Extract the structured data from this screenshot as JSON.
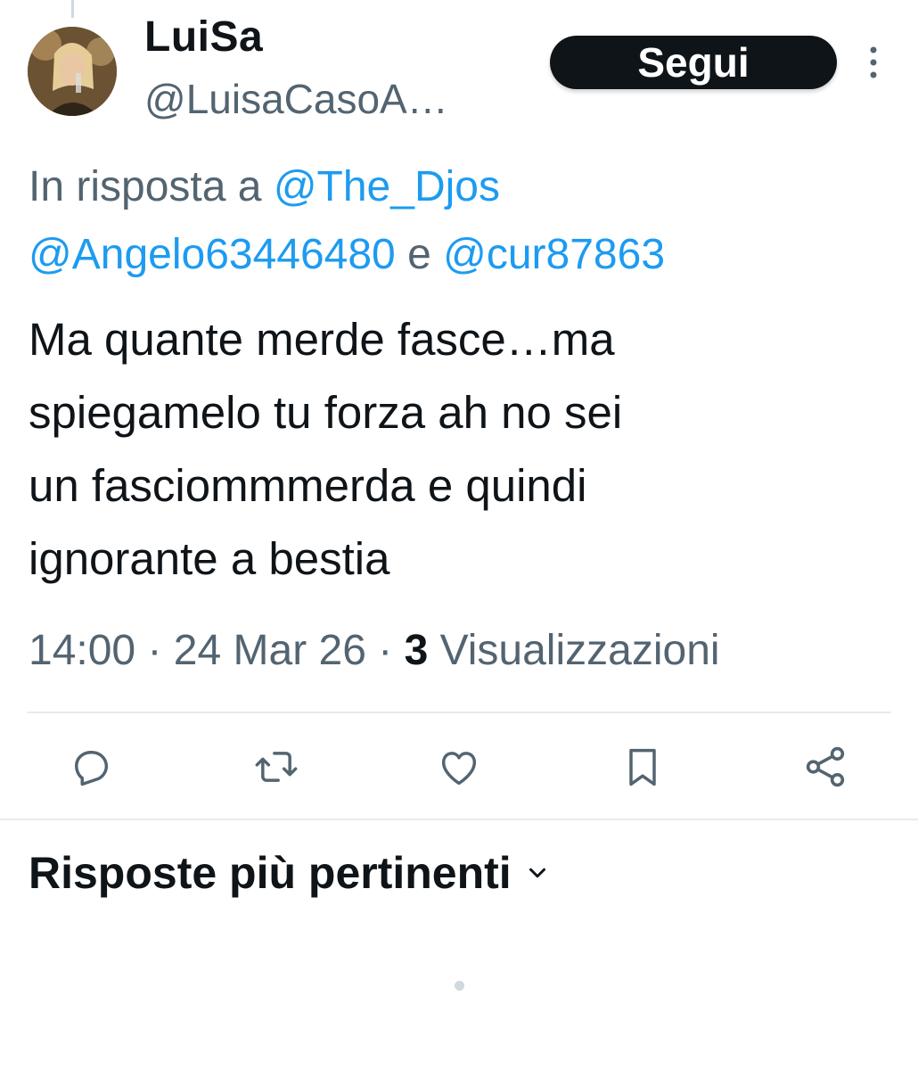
{
  "author": {
    "display_name": "LuiSa",
    "handle": "@LuisaCasoA…"
  },
  "follow_button": {
    "label": "Segui"
  },
  "more_icon": "more-vertical-icon",
  "reply_to": {
    "prefix": "In risposta a ",
    "mention_1": "@The_Djos",
    "mention_2": "@Angelo63446480",
    "conjunction": " e ",
    "mention_3": "@cur87863"
  },
  "tweet": {
    "text": "Ma quante merde fasce…ma\nspiegamelo tu forza ah no sei\nun fasciommmerda e quindi\nignorante a bestia"
  },
  "meta": {
    "time": "14:00",
    "separator": " · ",
    "date": "24 Mar 26",
    "views_count": "3",
    "views_label": " Visualizzazioni"
  },
  "actions": [
    {
      "icon": "reply-icon"
    },
    {
      "icon": "retweet-icon"
    },
    {
      "icon": "like-icon"
    },
    {
      "icon": "bookmark-icon"
    },
    {
      "icon": "share-icon"
    }
  ],
  "replies_sort": {
    "label": "Risposte più pertinenti",
    "icon": "chevron-down-icon"
  },
  "colors": {
    "link": "#1d9bf0",
    "secondary_text": "#536471",
    "primary_text": "#0f1419",
    "follow_bg": "#0f1419",
    "divider": "#e6ecf0"
  }
}
